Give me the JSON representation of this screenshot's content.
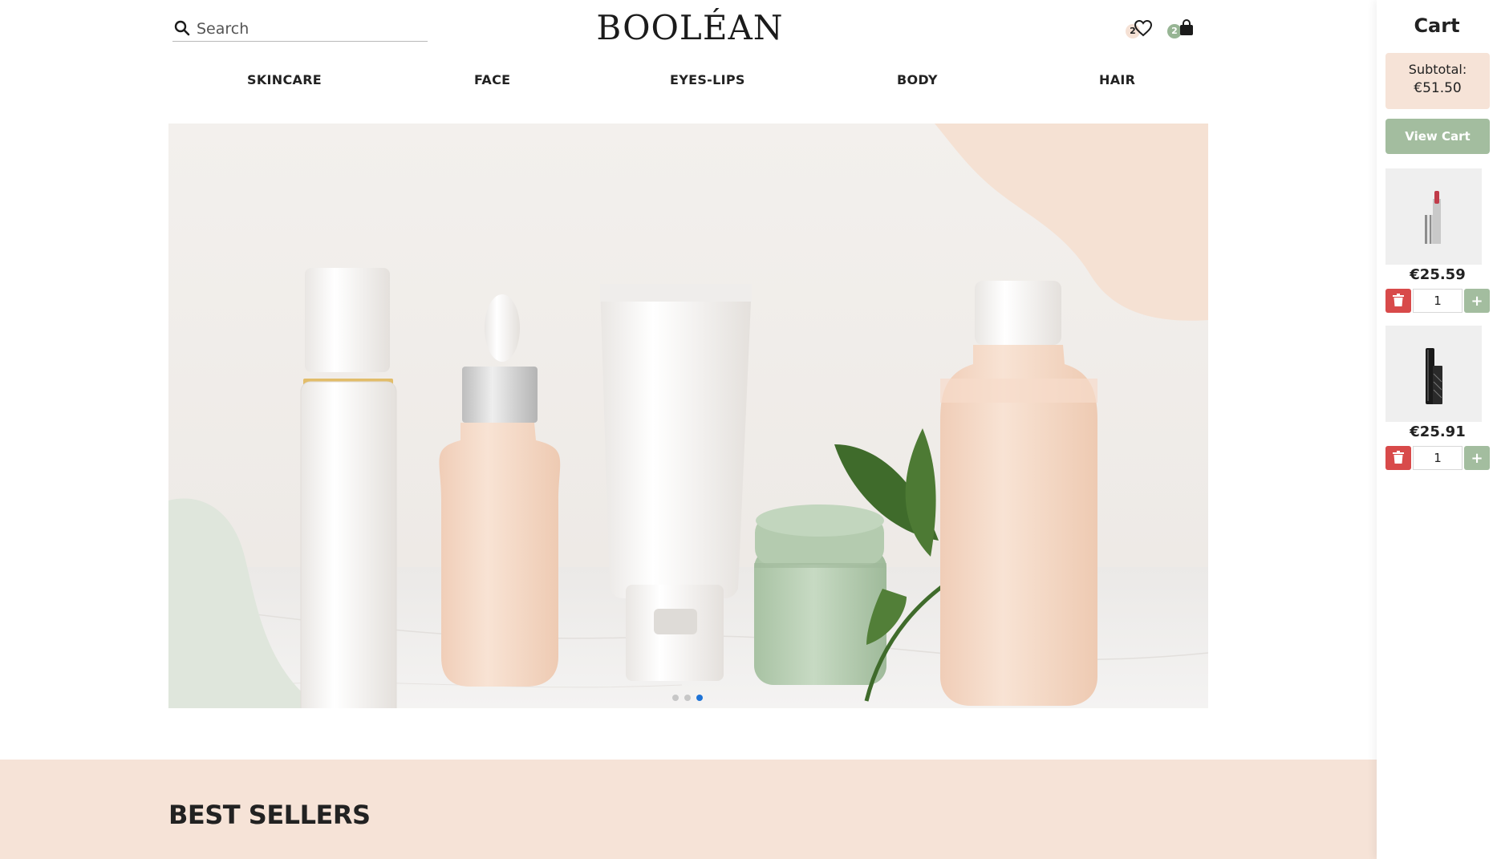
{
  "header": {
    "search_placeholder": "Search",
    "brand": "BOOLÉAN",
    "wishlist_count": "2",
    "cart_count": "2"
  },
  "nav": {
    "items": [
      {
        "label": "SKINCARE"
      },
      {
        "label": "FACE"
      },
      {
        "label": "EYES-LIPS"
      },
      {
        "label": "BODY"
      },
      {
        "label": "HAIR"
      }
    ]
  },
  "hero": {
    "slide_count": 3,
    "active_slide": 3
  },
  "best_sellers": {
    "title": "BEST SELLERS"
  },
  "cart": {
    "title": "Cart",
    "subtotal_label": "Subtotal:",
    "subtotal_value": "€51.50",
    "view_cart_label": "View Cart",
    "items": [
      {
        "product_icon": "lipstick-icon",
        "price": "€25.59",
        "quantity": "1"
      },
      {
        "product_icon": "mascara-icon",
        "price": "€25.91",
        "quantity": "1"
      }
    ]
  },
  "colors": {
    "accent_peach": "#f6e3d7",
    "accent_sage": "#a3bd9f",
    "delete_red": "#d84a4a",
    "active_dot": "#1e73d6"
  }
}
